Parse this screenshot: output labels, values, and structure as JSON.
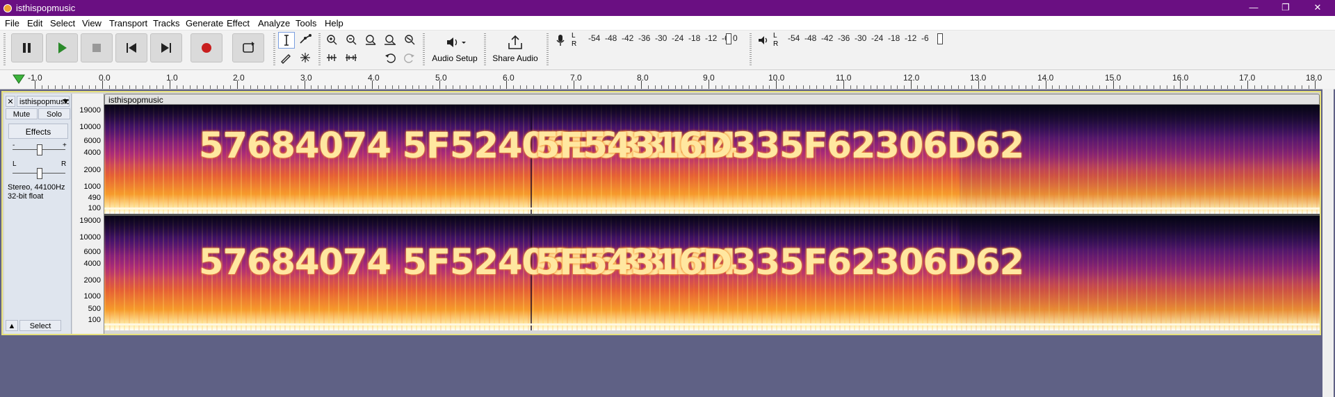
{
  "window": {
    "title": "isthispopmusic",
    "controls": [
      "—",
      "❐",
      "✕"
    ]
  },
  "menu": [
    "File",
    "Edit",
    "Select",
    "View",
    "Transport",
    "Tracks",
    "Generate",
    "Effect",
    "Analyze",
    "Tools",
    "Help"
  ],
  "toolbar": {
    "audio_setup_label": "Audio Setup",
    "share_audio_label": "Share Audio",
    "record_meter_scale": [
      "-54",
      "-48",
      "-42",
      "-36",
      "-30",
      "-24",
      "-18",
      "-12",
      "-6",
      "0"
    ],
    "play_meter_scale": [
      "-54",
      "-48",
      "-42",
      "-36",
      "-30",
      "-24",
      "-18",
      "-12",
      "-6",
      "0"
    ],
    "meter_lr": [
      "L",
      "R"
    ]
  },
  "ruler": {
    "labels": [
      "1.0",
      "0.0",
      "1.0",
      "2.0",
      "3.0",
      "4.0",
      "5.0",
      "6.0",
      "7.0",
      "8.0",
      "9.0",
      "10.0",
      "11.0",
      "12.0",
      "13.0",
      "14.0",
      "15.0",
      "16.0",
      "17.0",
      "18.0"
    ],
    "start_prefix": "-"
  },
  "track": {
    "name": "isthispopmusic",
    "clip_name": "isthispopmusic",
    "mute_label": "Mute",
    "solo_label": "Solo",
    "effects_label": "Effects",
    "gain_minus": "-",
    "gain_plus": "+",
    "pan_left": "L",
    "pan_right": "R",
    "info_line1": "Stereo, 44100Hz",
    "info_line2": "32-bit float",
    "select_label": "Select",
    "close_label": "✕",
    "collapse_label": "▲"
  },
  "frequency_scale": [
    "19000",
    "10000",
    "6000",
    "4000",
    "2000",
    "1000",
    "490",
    "100"
  ],
  "frequency_scale_bottom": [
    "19000",
    "10000",
    "6000",
    "4000",
    "2000",
    "1000",
    "500",
    "100"
  ],
  "spectrogram_text": {
    "part1": "57684074 5F52406E633164",
    "part2": "5F54316D335F62306D62"
  },
  "colors": {
    "title_bar": "#6a0f82",
    "background": "#5f6185",
    "selection_border": "#e6e07a"
  }
}
